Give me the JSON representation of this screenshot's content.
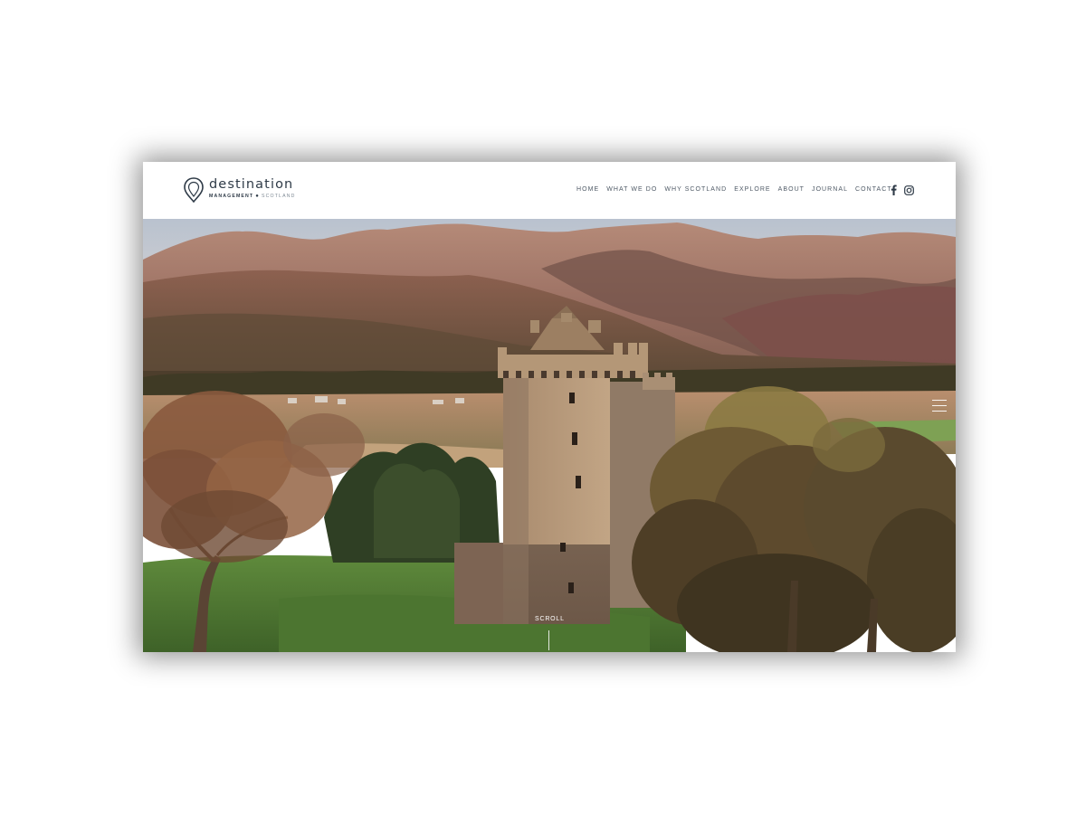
{
  "brand": {
    "name": "destination",
    "tagline_primary": "MANAGEMENT",
    "tagline_secondary": "SCOTLAND",
    "logo_icon": "map-pin-icon",
    "primary_color": "#2e3a47"
  },
  "nav": {
    "items": [
      {
        "label": "HOME"
      },
      {
        "label": "WHAT WE DO"
      },
      {
        "label": "WHY SCOTLAND"
      },
      {
        "label": "EXPLORE"
      },
      {
        "label": "ABOUT"
      },
      {
        "label": "JOURNAL"
      },
      {
        "label": "CONTACT"
      }
    ]
  },
  "social": {
    "icons": [
      "facebook-icon",
      "instagram-icon"
    ]
  },
  "hero": {
    "image_subject": "castle-tower-landscape",
    "scroll_label": "SCROLL",
    "menu_icon": "menu-icon"
  }
}
